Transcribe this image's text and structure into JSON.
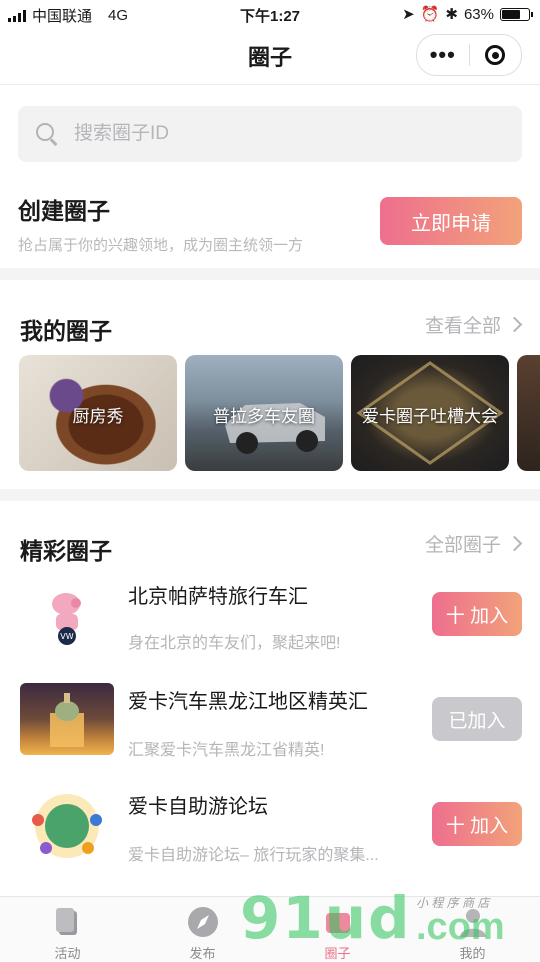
{
  "status": {
    "carrier": "中国联通",
    "network": "4G",
    "time": "下午1:27",
    "battery": "63%"
  },
  "navbar": {
    "title": "圈子",
    "more": "•••"
  },
  "search": {
    "placeholder": "搜索圈子ID"
  },
  "create": {
    "title": "创建圈子",
    "desc": "抢占属于你的兴趣领地，成为圈主统领一方",
    "button": "立即申请"
  },
  "my_circles": {
    "title": "我的圈子",
    "more": "查看全部",
    "cards": [
      {
        "label": "厨房秀"
      },
      {
        "label": "普拉多车友圈"
      },
      {
        "label": "爱卡圈子吐槽大会"
      },
      {
        "label": ""
      }
    ]
  },
  "featured": {
    "title": "精彩圈子",
    "more": "全部圈子",
    "items": [
      {
        "name": "北京帕萨特旅行车汇",
        "desc": "身在北京的车友们，聚起来吧!",
        "button": "十 加入",
        "state": "active"
      },
      {
        "name": "爱卡汽车黑龙江地区精英汇",
        "desc": "汇聚爱卡汽车黑龙江省精英!",
        "button": "已加入",
        "state": "joined"
      },
      {
        "name": "爱卡自助游论坛",
        "desc": "爱卡自助游论坛– 旅行玩家的聚集...",
        "button": "十 加入",
        "state": "active"
      }
    ]
  },
  "tabbar": {
    "tabs": [
      {
        "label": "活动"
      },
      {
        "label": "发布"
      },
      {
        "label": "圈子"
      },
      {
        "label": "我的"
      }
    ]
  },
  "watermark": {
    "text": "91ud",
    "domain": ".com",
    "tagline": "小 程 序 商 店"
  },
  "colors": {
    "accent_start": "#ee6f8e",
    "accent_end": "#f2a27a",
    "joined": "#c9c9cd"
  }
}
